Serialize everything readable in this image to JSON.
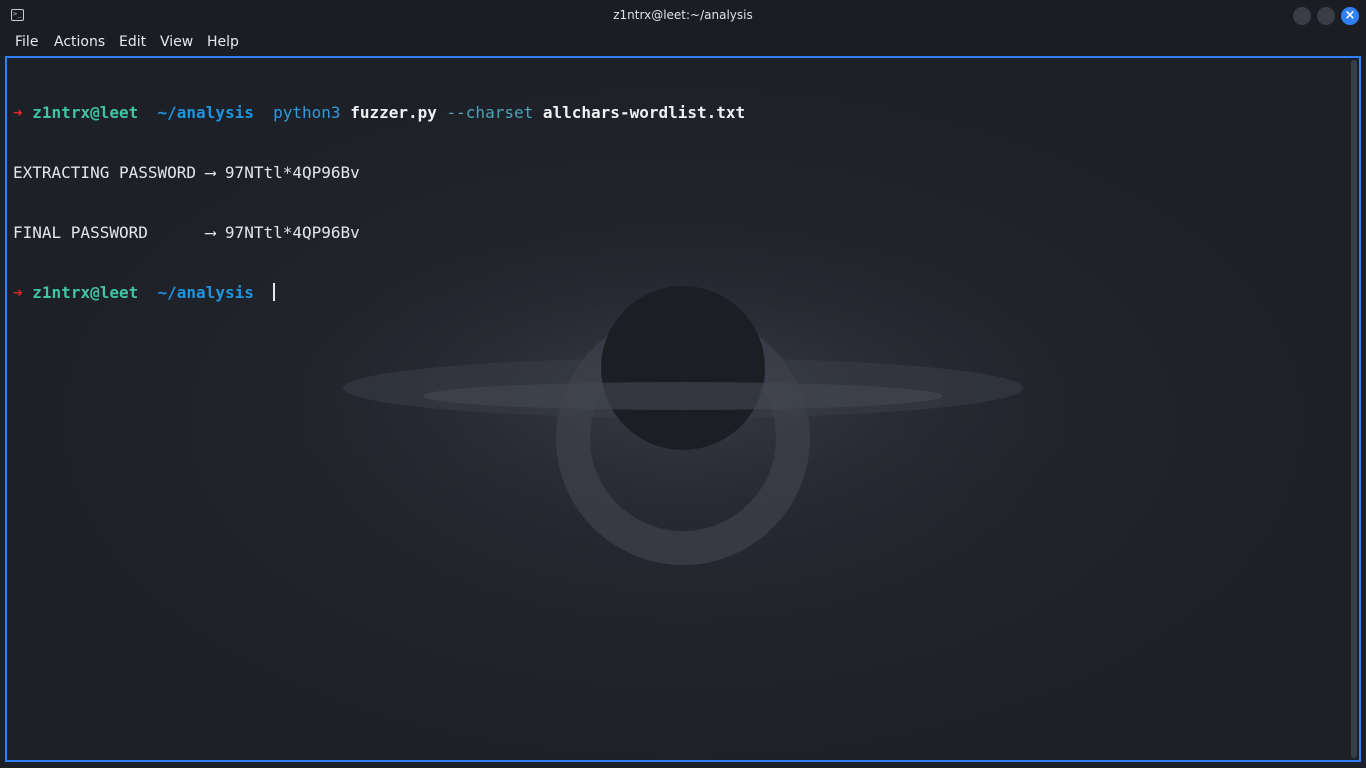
{
  "window": {
    "title": "z1ntrx@leet:~/analysis",
    "icon": "terminal-icon",
    "accent_color": "#2f7ff5"
  },
  "menu": {
    "file": "File",
    "actions": "Actions",
    "edit": "Edit",
    "view": "View",
    "help": "Help"
  },
  "prompt": {
    "arrow": "➜",
    "user": "z1ntrx",
    "at": "@",
    "host": "leet",
    "cwd": "~/analysis"
  },
  "command": {
    "python": "python3",
    "file": "fuzzer.py",
    "flag": "--charset",
    "arg": "allchars-wordlist.txt"
  },
  "output": [
    "EXTRACTING PASSWORD ⟶ 97NTtl*4QP96Bv",
    "FINAL PASSWORD      ⟶ 97NTtl*4QP96Bv"
  ],
  "colors": {
    "prompt_arrow": "#e0262a",
    "user_host": "#3fc5a3",
    "cwd": "#1e95e0"
  }
}
